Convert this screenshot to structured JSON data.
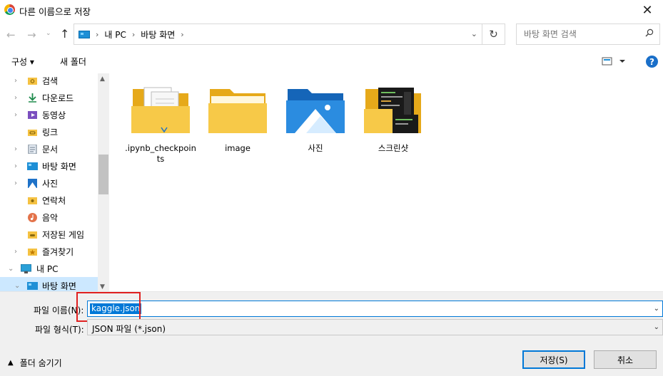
{
  "window": {
    "title": "다른 이름으로 저장",
    "close_icon": "✕"
  },
  "nav": {
    "breadcrumb": [
      "내 PC",
      "바탕 화면"
    ],
    "search_placeholder": "바탕 화면 검색"
  },
  "toolbar": {
    "organize_label": "구성 ▾",
    "new_folder_label": "새 폴더",
    "help_label": "?"
  },
  "sidebar": {
    "items": [
      {
        "label": "검색",
        "icon": "search-folder-icon"
      },
      {
        "label": "다운로드",
        "icon": "download-icon"
      },
      {
        "label": "동영상",
        "icon": "video-icon"
      },
      {
        "label": "링크",
        "icon": "links-folder-icon"
      },
      {
        "label": "문서",
        "icon": "document-icon"
      },
      {
        "label": "바탕 화면",
        "icon": "desktop-icon"
      },
      {
        "label": "사진",
        "icon": "pictures-icon"
      },
      {
        "label": "연락처",
        "icon": "contacts-icon"
      },
      {
        "label": "음악",
        "icon": "music-icon"
      },
      {
        "label": "저장된 게임",
        "icon": "saved-games-icon"
      },
      {
        "label": "즐겨찾기",
        "icon": "favorites-icon"
      },
      {
        "label": "내 PC",
        "icon": "pc-icon"
      },
      {
        "label": "바탕 화면",
        "icon": "desktop-icon"
      }
    ]
  },
  "files": [
    {
      "name": ".ipynb_checkpoints",
      "icon": "folder-with-files-icon"
    },
    {
      "name": "image",
      "icon": "folder-icon"
    },
    {
      "name": "사진",
      "icon": "pictures-folder-icon"
    },
    {
      "name": "스크린샷",
      "icon": "screenshots-folder-icon"
    }
  ],
  "form": {
    "filename_label": "파일 이름(N):",
    "filename_value": "kaggle.json",
    "type_label": "파일 형식(T):",
    "type_value": "JSON 파일 (*.json)",
    "hide_folders_label": "폴더 숨기기",
    "save_label": "저장(S)",
    "cancel_label": "취소"
  },
  "colors": {
    "accent": "#0078d7",
    "highlight_box": "#e02020",
    "selection_bg": "#cce8ff",
    "folder": "#f7c948"
  }
}
